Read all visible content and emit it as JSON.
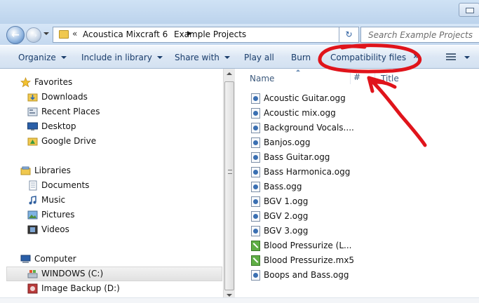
{
  "navigation": {
    "breadcrumb_overflow": "«",
    "breadcrumbs": [
      "Acoustica Mixcraft 6",
      "Example Projects"
    ],
    "search_placeholder": "Search Example Projects"
  },
  "toolbar": {
    "organize": "Organize",
    "include_in_library": "Include in library",
    "share_with": "Share with",
    "play_all": "Play all",
    "burn": "Burn",
    "compatibility_files": "Compatibility files",
    "more": "»"
  },
  "sidebar": {
    "favorites": {
      "label": "Favorites",
      "items": [
        {
          "label": "Downloads",
          "icon": "downloads-icon"
        },
        {
          "label": "Recent Places",
          "icon": "recent-places-icon"
        },
        {
          "label": "Desktop",
          "icon": "desktop-icon"
        },
        {
          "label": "Google Drive",
          "icon": "google-drive-icon"
        }
      ]
    },
    "libraries": {
      "label": "Libraries",
      "items": [
        {
          "label": "Documents",
          "icon": "documents-icon"
        },
        {
          "label": "Music",
          "icon": "music-icon"
        },
        {
          "label": "Pictures",
          "icon": "pictures-icon"
        },
        {
          "label": "Videos",
          "icon": "videos-icon"
        }
      ]
    },
    "computer": {
      "label": "Computer",
      "items": [
        {
          "label": "WINDOWS (C:)",
          "icon": "drive-icon",
          "selected": true
        },
        {
          "label": "Image Backup (D:)",
          "icon": "backup-drive-icon"
        }
      ]
    }
  },
  "file_list": {
    "columns": [
      "Name",
      "#",
      "Title"
    ],
    "files": [
      {
        "name": "Acoustic Guitar.ogg",
        "type": "ogg"
      },
      {
        "name": "Acoustic mix.ogg",
        "type": "ogg"
      },
      {
        "name": "Background Vocals....",
        "type": "ogg"
      },
      {
        "name": "Banjos.ogg",
        "type": "ogg"
      },
      {
        "name": "Bass Guitar.ogg",
        "type": "ogg"
      },
      {
        "name": "Bass Harmonica.ogg",
        "type": "ogg"
      },
      {
        "name": "Bass.ogg",
        "type": "ogg"
      },
      {
        "name": "BGV 1.ogg",
        "type": "ogg"
      },
      {
        "name": "BGV 2.ogg",
        "type": "ogg"
      },
      {
        "name": "BGV 3.ogg",
        "type": "ogg"
      },
      {
        "name": "Blood Pressurize (L...",
        "type": "mx5"
      },
      {
        "name": "Blood Pressurize.mx5",
        "type": "mx5"
      },
      {
        "name": "Boops and Bass.ogg",
        "type": "ogg"
      }
    ]
  },
  "colors": {
    "annotation": "#e0141b",
    "command_text": "#1a3d6b",
    "header_text": "#3d5a7d"
  }
}
